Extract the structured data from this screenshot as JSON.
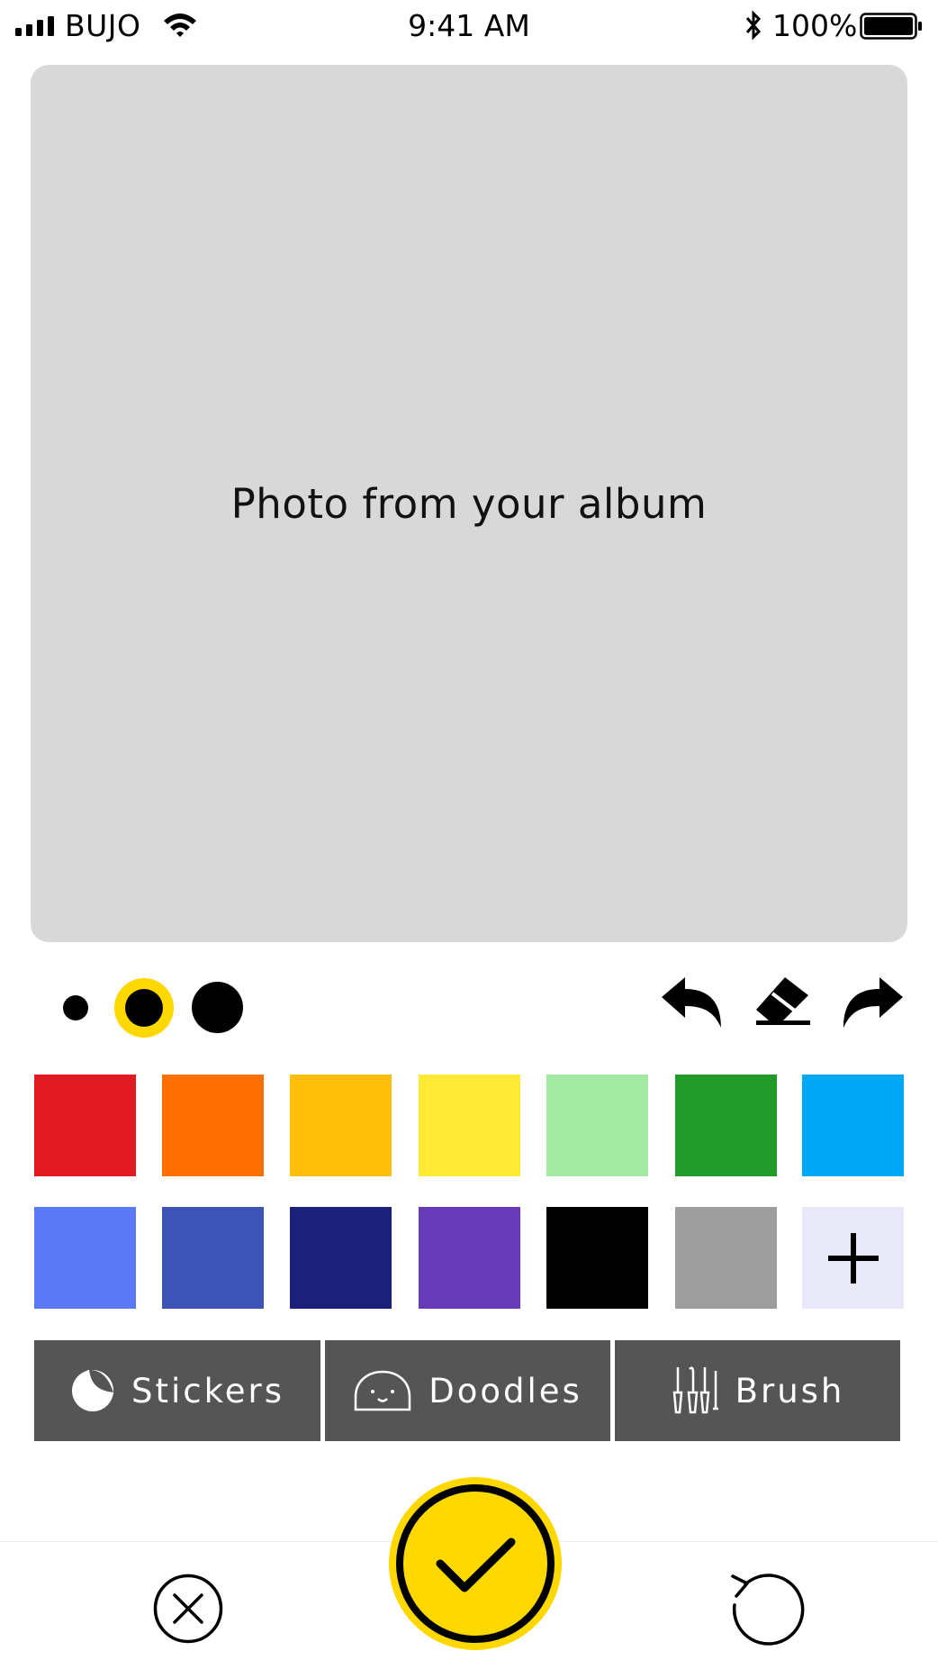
{
  "status_bar": {
    "carrier": "BUJO",
    "time": "9:41 AM",
    "battery_percent": "100%"
  },
  "canvas": {
    "placeholder": "Photo from your album",
    "background": "#d8d8d8"
  },
  "brush_sizes": {
    "options": [
      "small",
      "medium",
      "large"
    ],
    "selected": "medium",
    "selected_ring_color": "#ffd800"
  },
  "tools": [
    "undo-icon",
    "eraser-icon",
    "redo-icon"
  ],
  "palette": {
    "row1": [
      "#e21b23",
      "#ff6f00",
      "#ffbf0a",
      "#ffea38",
      "#a3e9a4",
      "#229a2a",
      "#00a7f4"
    ],
    "row2": [
      "#5a79f7",
      "#3d53b6",
      "#1b207a",
      "#673ab7",
      "#000000",
      "#9e9e9e"
    ],
    "add_icon": "plus-icon"
  },
  "tabs": [
    {
      "label": "Stickers",
      "icon": "sticker-icon"
    },
    {
      "label": "Doodles",
      "icon": "doodle-face-icon"
    },
    {
      "label": "Brush",
      "icon": "brushes-icon"
    }
  ],
  "actions": {
    "cancel_icon": "close-circle-icon",
    "confirm_icon": "check-icon",
    "reset_icon": "reset-icon",
    "accent": "#ffd800"
  }
}
